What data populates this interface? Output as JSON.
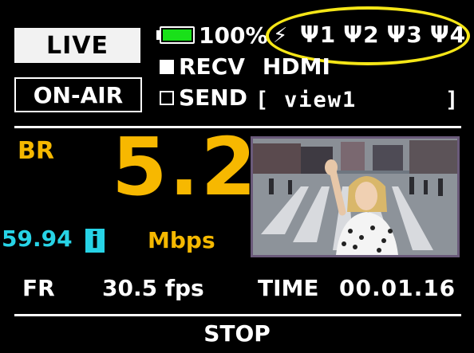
{
  "header": {
    "live_label": "LIVE",
    "onair_label": "ON-AIR"
  },
  "status": {
    "battery_percent_text": "100%",
    "battery_level": 1.0,
    "battery_color": "#19e019",
    "link_icon": "lightning-icon",
    "antennas": [
      {
        "symbol": "Ψ",
        "label": "1"
      },
      {
        "symbol": "Ψ",
        "label": "2"
      },
      {
        "symbol": "Ψ",
        "label": "3"
      },
      {
        "symbol": "Ψ",
        "label": "4"
      }
    ],
    "highlight_color": "#f5e617"
  },
  "mode": {
    "recv_label": "RECV",
    "recv_source": "HDMI",
    "send_label": "SEND",
    "view_open": "[",
    "view_name": "view1",
    "view_close": "]"
  },
  "bitrate": {
    "label": "BR",
    "value": "5.2",
    "unit": "Mbps",
    "color": "#f7b800"
  },
  "framerate_mode": {
    "value": "59.94",
    "info_icon": "i",
    "color": "#27d3e6"
  },
  "stats": {
    "fr_label": "FR",
    "fr_value": "30.5 fps",
    "time_label": "TIME",
    "time_value": "00.01.16"
  },
  "footer": {
    "stop_label": "STOP"
  }
}
